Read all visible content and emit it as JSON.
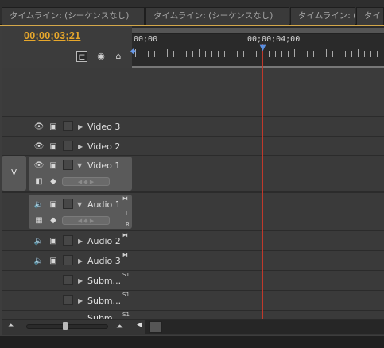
{
  "tabs": [
    {
      "label": "タイムライン: (シーケンスなし)"
    },
    {
      "label": "タイムライン: (シーケンスなし)"
    },
    {
      "label": "タイムライン: (シーケンスなし)"
    },
    {
      "label": "タイ"
    }
  ],
  "timecode": "00;00;03;21",
  "ruler": {
    "start_label": "00;00",
    "mid_label": "00;00;04;00"
  },
  "target_label": "V",
  "tracks": [
    {
      "name": "Video 3",
      "type": "video",
      "expanded": false
    },
    {
      "name": "Video 2",
      "type": "video",
      "expanded": false
    },
    {
      "name": "Video 1",
      "type": "video",
      "expanded": true
    },
    {
      "name": "Audio 1",
      "type": "audio",
      "expanded": true
    },
    {
      "name": "Audio 2",
      "type": "audio",
      "expanded": false
    },
    {
      "name": "Audio 3",
      "type": "audio",
      "expanded": false
    },
    {
      "name": "Subm...",
      "type": "submix",
      "tag": "S1"
    },
    {
      "name": "Subm...",
      "type": "submix",
      "tag": "S1"
    },
    {
      "name": "Subm...",
      "type": "submix",
      "tag": "S1"
    }
  ],
  "audio1_channels": {
    "left": "L",
    "right": "R"
  },
  "colors": {
    "timecode": "#e7a72b",
    "playhead": "#c0392b",
    "panel_accent": "#d4a84a"
  },
  "icons": [
    "snap-icon",
    "marker-icon",
    "keyframe-icon",
    "eye-icon",
    "film-icon",
    "speaker-icon",
    "zoom-out-icon",
    "zoom-in-icon"
  ]
}
